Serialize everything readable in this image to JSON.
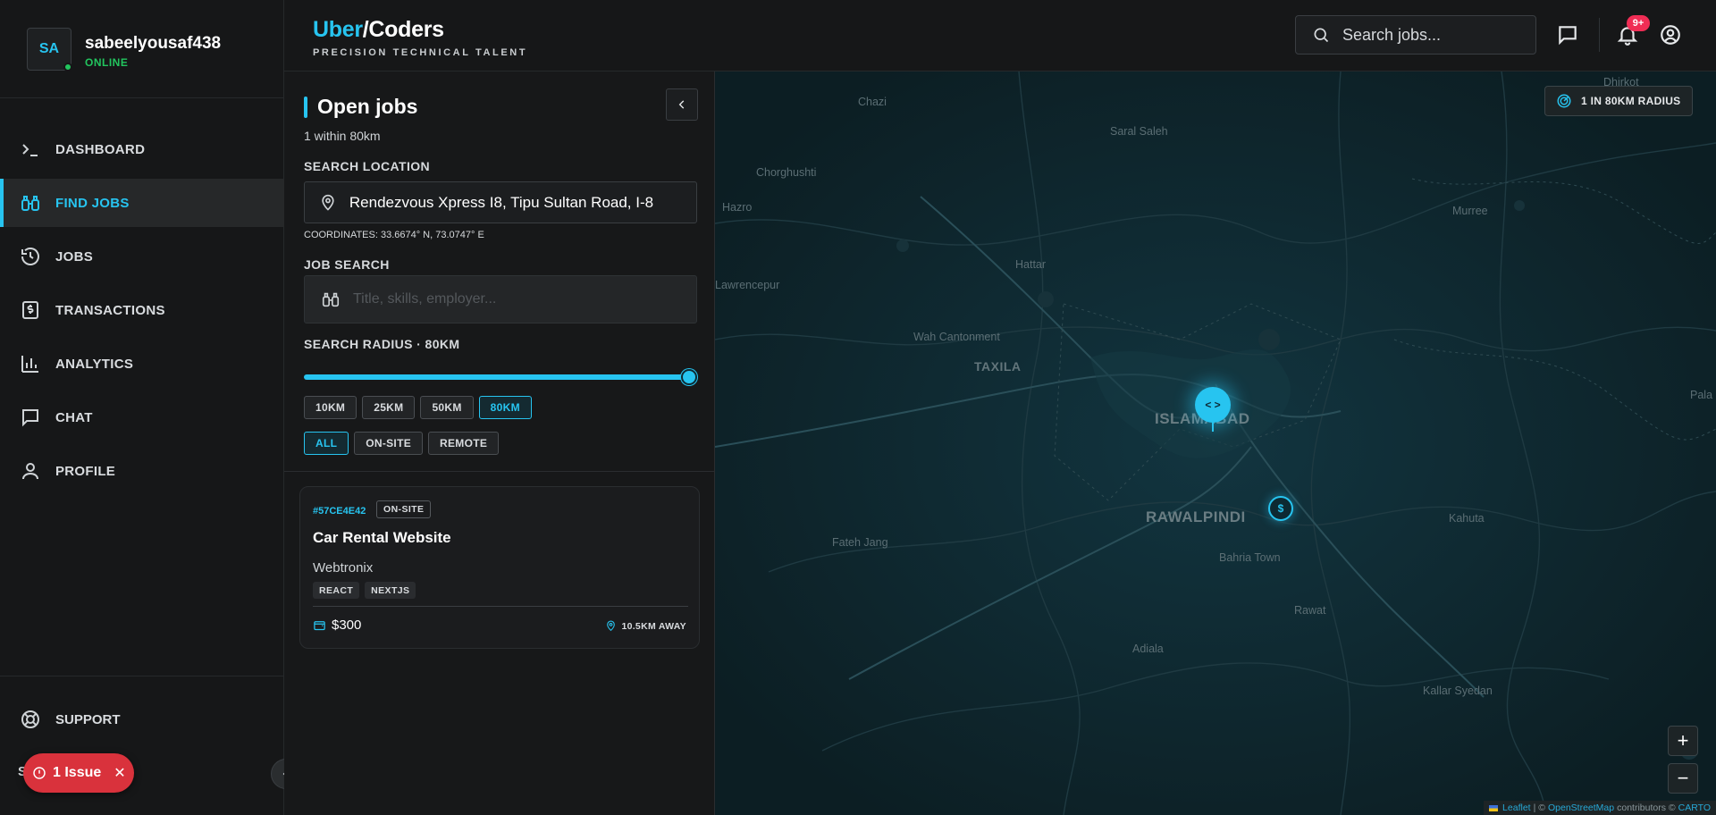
{
  "user": {
    "initials": "SA",
    "name": "sabeelyousaf438",
    "status": "ONLINE"
  },
  "nav": [
    {
      "label": "DASHBOARD",
      "icon": "terminal-icon"
    },
    {
      "label": "FIND JOBS",
      "icon": "binoculars-icon",
      "active": true
    },
    {
      "label": "JOBS",
      "icon": "history-icon"
    },
    {
      "label": "TRANSACTIONS",
      "icon": "receipt-icon"
    },
    {
      "label": "ANALYTICS",
      "icon": "bar-chart-icon"
    },
    {
      "label": "CHAT",
      "icon": "message-icon"
    },
    {
      "label": "PROFILE",
      "icon": "user-icon"
    }
  ],
  "support": {
    "label": "SUPPORT"
  },
  "issue": {
    "label": "1 Issue"
  },
  "header": {
    "brand_uber": "Uber",
    "brand_rest": "/Coders",
    "tagline": "PRECISION TECHNICAL TALENT",
    "search_placeholder": "Search jobs...",
    "notification_count": "9+"
  },
  "panel": {
    "title": "Open jobs",
    "subtitle": "1 within 80km",
    "location_label": "SEARCH LOCATION",
    "location_value": "Rendezvous Xpress I8, Tipu Sultan Road, I-8",
    "coordinates": "COORDINATES: 33.6674° N, 73.0747° E",
    "job_search_label": "JOB SEARCH",
    "job_search_placeholder": "Title, skills, employer...",
    "radius_label": "SEARCH RADIUS · 80KM",
    "radius_fraction": 1.0,
    "radius_options": [
      "10KM",
      "25KM",
      "50KM",
      "80KM"
    ],
    "radius_selected": "80KM",
    "type_options": [
      "ALL",
      "ON-SITE",
      "REMOTE"
    ],
    "type_selected": "ALL"
  },
  "jobs": [
    {
      "id": "#57CE4E42",
      "type": "ON-SITE",
      "title": "Car Rental Website",
      "employer": "Webtronix",
      "tags": [
        "REACT",
        "NEXTJS"
      ],
      "price": "$300",
      "distance": "10.5KM AWAY"
    }
  ],
  "map": {
    "radius_badge": "1 IN 80KM RADIUS",
    "job_marker": "< >",
    "user_marker": "$",
    "zoom_in": "+",
    "zoom_out": "−",
    "places": [
      "Chazi",
      "Saral Saleh",
      "Chorghushti",
      "Hazro",
      "Murree",
      "Hattar",
      "Lawrencepur",
      "Wah Cantonment",
      "TAXILA",
      "ISLAMABAD",
      "RAWALPINDI",
      "Fateh Jang",
      "Bahria Town",
      "Kahuta",
      "Rawat",
      "Adiala",
      "Kallar Syedan",
      "Dhirkot",
      "Pala"
    ],
    "attribution": {
      "leaflet": "Leaflet",
      "sep": "| ©",
      "osm": "OpenStreetMap",
      "contrib": "contributors ©",
      "carto": "CARTO"
    }
  }
}
